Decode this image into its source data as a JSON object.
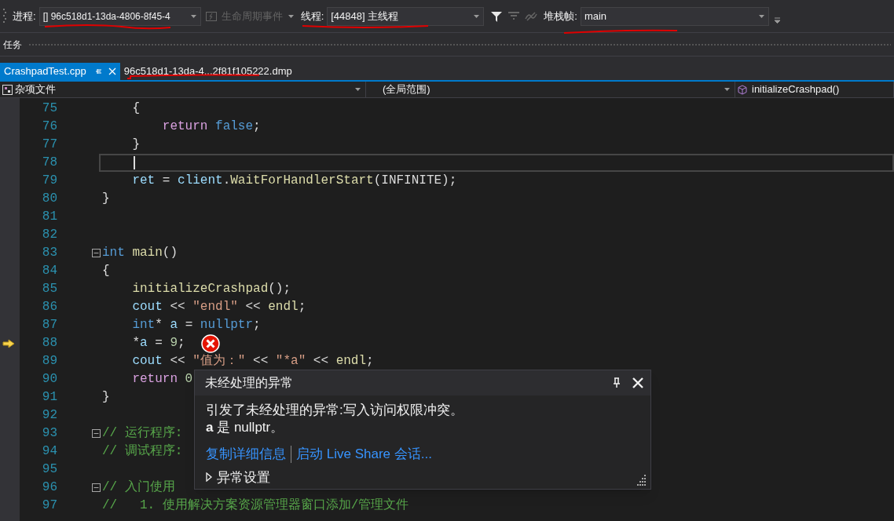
{
  "toolbar": {
    "process_label": "进程:",
    "process_value": "[] 96c518d1-13da-4806-8f45-4",
    "lifecycle_events": {
      "label": "生命周期事件",
      "disabled": true
    },
    "thread_label": "线程:",
    "thread_value": "[44848] 主线程",
    "stack_frame_label": "堆栈帧:",
    "stack_frame_value": "main"
  },
  "tasks_bar": {
    "title": "任务"
  },
  "tabs": [
    {
      "label": "CrashpadTest.cpp",
      "selected": true
    },
    {
      "label": "96c518d1-13da-4...2f81f105222.dmp",
      "selected": false
    }
  ],
  "navigation_bar": {
    "project": "杂项文件",
    "scope": "(全局范围)",
    "member": "initializeCrashpad()"
  },
  "editor": {
    "lines": [
      {
        "number": "75",
        "tokens": [
          {
            "kind": "plain",
            "text": "    {"
          }
        ]
      },
      {
        "number": "76",
        "tokens": [
          {
            "kind": "control",
            "text": "        return"
          },
          {
            "kind": "keyword",
            "text": " false"
          },
          {
            "kind": "plain",
            "text": ";"
          }
        ]
      },
      {
        "number": "77",
        "tokens": [
          {
            "kind": "plain",
            "text": "    }"
          }
        ]
      },
      {
        "number": "78",
        "caret_line": true
      },
      {
        "number": "79",
        "tokens": [
          {
            "kind": "variable",
            "text": "    ret"
          },
          {
            "kind": "plain",
            "text": " = "
          },
          {
            "kind": "variable",
            "text": "client"
          },
          {
            "kind": "plain",
            "text": "."
          },
          {
            "kind": "function",
            "text": "WaitForHandlerStart"
          },
          {
            "kind": "plain",
            "text": "(INFINITE);"
          }
        ]
      },
      {
        "number": "80",
        "tokens": [
          {
            "kind": "plain",
            "text": "}"
          }
        ]
      },
      {
        "number": "81"
      },
      {
        "number": "82"
      },
      {
        "number": "83",
        "fold": true,
        "tokens": [
          {
            "kind": "keyword",
            "text": "int"
          },
          {
            "kind": "function",
            "text": " main"
          },
          {
            "kind": "plain",
            "text": "()"
          }
        ]
      },
      {
        "number": "84",
        "tokens": [
          {
            "kind": "plain",
            "text": "{"
          }
        ]
      },
      {
        "number": "85",
        "tokens": [
          {
            "kind": "function",
            "text": "    initializeCrashpad"
          },
          {
            "kind": "plain",
            "text": "();"
          }
        ]
      },
      {
        "number": "86",
        "tokens": [
          {
            "kind": "variable",
            "text": "    cout"
          },
          {
            "kind": "plain",
            "text": " << "
          },
          {
            "kind": "string",
            "text": "\"endl\""
          },
          {
            "kind": "plain",
            "text": " << "
          },
          {
            "kind": "function",
            "text": "endl"
          },
          {
            "kind": "plain",
            "text": ";"
          }
        ]
      },
      {
        "number": "87",
        "tokens": [
          {
            "kind": "keyword",
            "text": "    int"
          },
          {
            "kind": "plain",
            "text": "* "
          },
          {
            "kind": "variable",
            "text": "a"
          },
          {
            "kind": "plain",
            "text": " = "
          },
          {
            "kind": "keyword",
            "text": "nullptr"
          },
          {
            "kind": "plain",
            "text": ";"
          }
        ]
      },
      {
        "number": "88",
        "execution_point": true,
        "exception": true,
        "tokens": [
          {
            "kind": "plain",
            "text": "    *"
          },
          {
            "kind": "variable",
            "text": "a"
          },
          {
            "kind": "plain",
            "text": " = "
          },
          {
            "kind": "number",
            "text": "9"
          },
          {
            "kind": "plain",
            "text": ";"
          }
        ]
      },
      {
        "number": "89",
        "tokens": [
          {
            "kind": "variable",
            "text": "    cout"
          },
          {
            "kind": "plain",
            "text": " << "
          },
          {
            "kind": "string",
            "text": "\"值为：\""
          },
          {
            "kind": "plain",
            "text": " << "
          },
          {
            "kind": "string",
            "text": "\"*a\""
          },
          {
            "kind": "plain",
            "text": " << "
          },
          {
            "kind": "function",
            "text": "endl"
          },
          {
            "kind": "plain",
            "text": ";"
          }
        ]
      },
      {
        "number": "90",
        "tokens": [
          {
            "kind": "control",
            "text": "    return"
          },
          {
            "kind": "number",
            "text": " 0"
          }
        ]
      },
      {
        "number": "91",
        "tokens": [
          {
            "kind": "plain",
            "text": "}"
          }
        ]
      },
      {
        "number": "92"
      },
      {
        "number": "93",
        "fold": true,
        "tokens": [
          {
            "kind": "comment",
            "text": "// 运行程序:"
          }
        ]
      },
      {
        "number": "94",
        "tokens": [
          {
            "kind": "comment",
            "text": "// 调试程序:"
          }
        ]
      },
      {
        "number": "95"
      },
      {
        "number": "96",
        "fold": true,
        "tokens": [
          {
            "kind": "comment",
            "text": "// 入门使用"
          }
        ]
      },
      {
        "number": "97",
        "tokens": [
          {
            "kind": "comment",
            "text": "//   1. 使用解决方案资源管理器窗口添加/管理文件"
          }
        ]
      }
    ]
  },
  "exception_popup": {
    "title": "未经处理的异常",
    "message": "引发了未经处理的异常:写入访问权限冲突。",
    "detail": "**a** 是 nullptr。",
    "links": [
      "复制详细信息",
      "启动 Live Share 会话..."
    ],
    "settings": {
      "label": "异常设置",
      "expanded": false
    }
  }
}
